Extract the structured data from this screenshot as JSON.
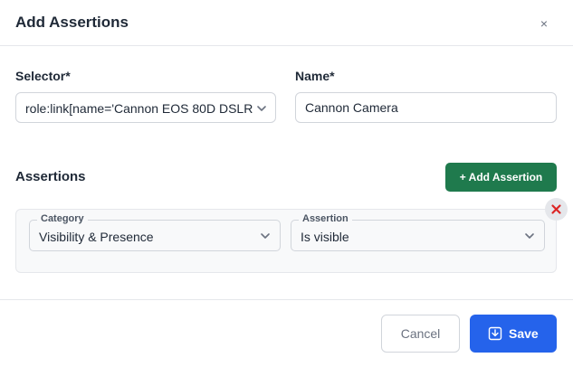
{
  "dialog": {
    "title": "Add Assertions",
    "close_label": "×"
  },
  "selector": {
    "label": "Selector*",
    "value": "role:link[name='Cannon EOS 80D DSLR"
  },
  "name": {
    "label": "Name*",
    "value": "Cannon Camera"
  },
  "assertions": {
    "title": "Assertions",
    "add_label": "+ Add Assertion",
    "items": [
      {
        "category_label": "Category",
        "category_value": "Visibility & Presence",
        "assertion_label": "Assertion",
        "assertion_value": "Is visible"
      }
    ]
  },
  "footer": {
    "cancel_label": "Cancel",
    "save_label": "Save"
  },
  "icons": {
    "close": "close-icon",
    "chevron": "chevron-down-icon",
    "remove": "x-circle-icon",
    "save": "download-save-icon"
  },
  "colors": {
    "add_button": "#1f7a4d",
    "save_button": "#2563eb",
    "remove_icon": "#dc2626"
  }
}
